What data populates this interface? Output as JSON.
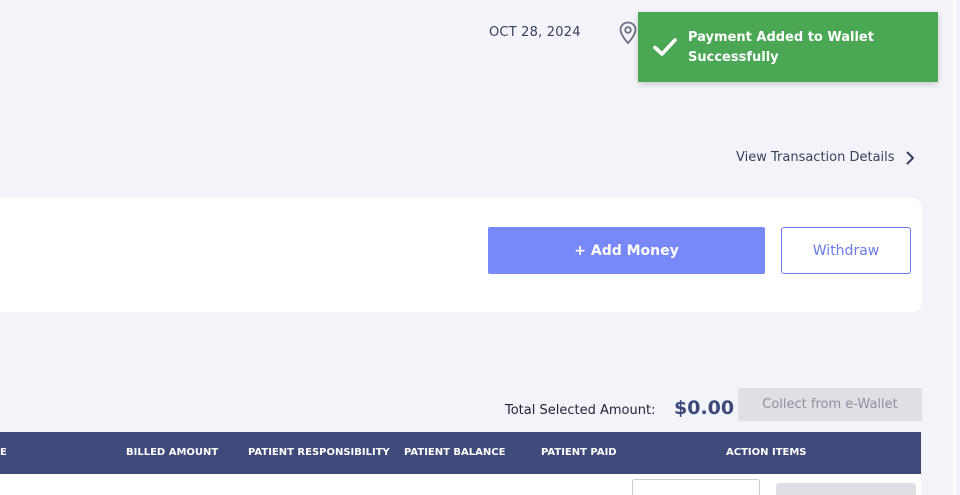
{
  "header": {
    "date": "OCT 28, 2024",
    "location_icon": "map-pin-icon"
  },
  "toast": {
    "icon": "check-icon",
    "message": "Payment Added to Wallet Successfully",
    "color": "#4aa754"
  },
  "wallet": {
    "view_transaction_link": "View Transaction Details",
    "add_money_label": "+ Add Money",
    "withdraw_label": "Withdraw",
    "accent": "#7789f8"
  },
  "summary": {
    "total_label": "Total Selected Amount:",
    "total_value": "$0.00",
    "collect_label": "Collect from e-Wallet"
  },
  "table": {
    "columns": [
      "E",
      "BILLED AMOUNT",
      "PATIENT RESPONSIBILITY",
      "PATIENT BALANCE",
      "PATIENT PAID",
      "ACTION ITEMS"
    ],
    "header_color": "#3e4a7a"
  }
}
